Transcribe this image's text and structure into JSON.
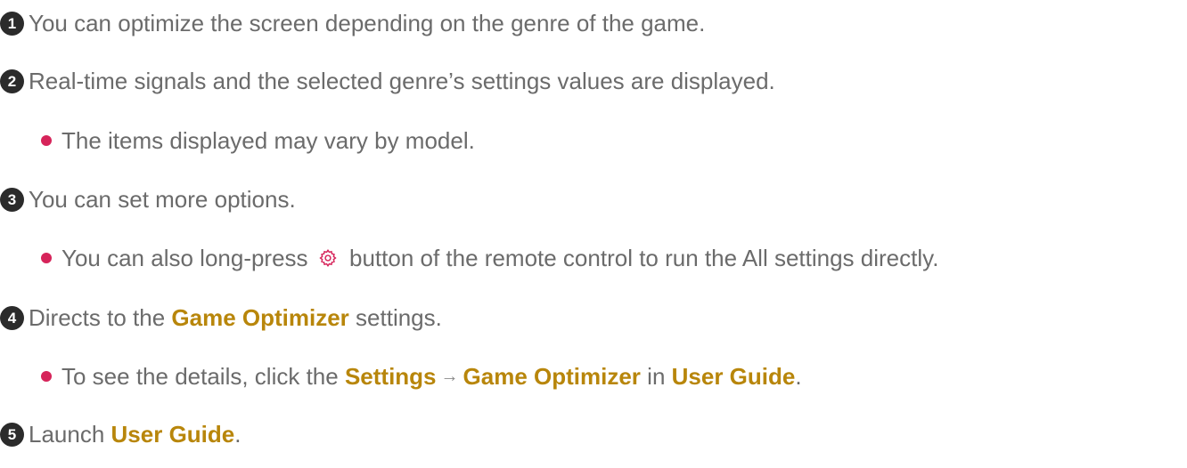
{
  "items": [
    {
      "number": "1",
      "text": "You can optimize the screen depending on the genre of the game."
    },
    {
      "number": "2",
      "text": "Real-time signals and the selected genre’s settings values are displayed."
    },
    {
      "number": "3",
      "text": "You can set more options."
    },
    {
      "number": "4",
      "text_before": "Directs to the ",
      "highlight": "Game Optimizer",
      "text_after": " settings."
    },
    {
      "number": "5",
      "text_before": "Launch ",
      "highlight": "User Guide",
      "text_after": "."
    }
  ],
  "notes": {
    "note_2": {
      "text": "The items displayed may vary by model."
    },
    "note_3": {
      "text_before": "You can also long-press ",
      "icon": "settings-gear-icon",
      "text_after": " button of the remote control to run the All settings directly."
    },
    "note_4": {
      "text_before": "To see the details, click the ",
      "highlight_1": "Settings",
      "arrow": "→",
      "highlight_2": "Game Optimizer",
      "text_middle": " in ",
      "highlight_3": "User Guide",
      "text_after": "."
    }
  },
  "colors": {
    "body_text": "#6b6b6b",
    "highlight": "#b8860b",
    "bullet": "#d6245a",
    "number_badge": "#2b2b2b",
    "gear_icon": "#d6245a"
  }
}
